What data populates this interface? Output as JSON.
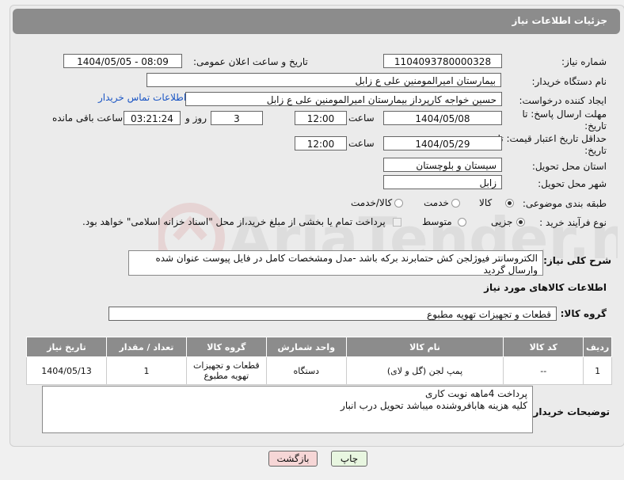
{
  "header": {
    "title": "جزئیات اطلاعات نیاز"
  },
  "form": {
    "need_number_label": "شماره نیاز:",
    "need_number": "1104093780000328",
    "announce_label": "تاریخ و ساعت اعلان عمومی:",
    "announce_value": "1404/05/05 - 08:09",
    "buyer_org_label": "نام دستگاه خریدار:",
    "buyer_org": "بیمارستان امیرالمومنین علی  ع  زابل",
    "creator_label": "ایجاد کننده درخواست:",
    "creator": "حسین خواجه کارپرداز بیمارستان امیرالمومنین علی  ع  زابل",
    "contact_link": "اطلاعات تماس خریدار",
    "reply_deadline_label": "مهلت ارسال پاسخ: تا تاریخ:",
    "reply_date": "1404/05/08",
    "time_label": "ساعت",
    "reply_time": "12:00",
    "days_value": "3",
    "days_label": "روز و",
    "remaining_value": "03:21:24",
    "remaining_label": "ساعت باقی مانده",
    "price_valid_label": "حداقل تاریخ اعتبار قیمت: تا تاریخ:",
    "price_date": "1404/05/29",
    "price_time": "12:00",
    "province_label": "استان محل تحویل:",
    "province": "سیستان و بلوچستان",
    "city_label": "شهر محل تحویل:",
    "city": "زابل",
    "category_label": "طبقه بندی موضوعی:",
    "category_options": [
      "کالا",
      "خدمت",
      "کالا/خدمت"
    ],
    "process_label": "نوع فرآیند خرید :",
    "process_options": [
      "جزیی",
      "متوسط"
    ],
    "treasury_note": "پرداخت تمام یا بخشی از مبلغ خرید،از محل \"اسناد خزانه اسلامی\" خواهد بود."
  },
  "description": {
    "label": "شرح کلی نیاز:",
    "text": "الکتروسانتر فیوژلجن کش حتمابرند برکه باشد -مدل ومشخصات کامل در فایل پیوست عنوان شده وارسال گردید"
  },
  "goods": {
    "section_title": "اطلاعات کالاهای مورد نیاز",
    "group_label": "گروه کالا:",
    "group_value": "قطعات و تجهیزات تهویه مطبوع",
    "columns": [
      "ردیف",
      "کد کالا",
      "نام کالا",
      "واحد شمارش",
      "گروه کالا",
      "تعداد / مقدار",
      "تاریخ نیاز"
    ],
    "rows": [
      [
        "1",
        "--",
        "پمپ لجن (گل و لای)",
        "دستگاه",
        "قطعات و تجهیزات تهویه مطبوع",
        "1",
        "1404/05/13"
      ]
    ]
  },
  "buyer_notes": {
    "label": "توضیحات خریدار:",
    "line1": "پرداخت 4ماهه نوبت کاری",
    "line2": "کلیه هزینه هابافروشنده میباشد تحویل درب انبار"
  },
  "buttons": {
    "print": "چاپ",
    "back": "بازگشت"
  },
  "watermark": "AriaTender.net",
  "colors": {
    "header": "#8c8c8c",
    "link": "#1a55c4",
    "back_button": "#f6d6d6",
    "print_button": "#e8f6e0"
  }
}
